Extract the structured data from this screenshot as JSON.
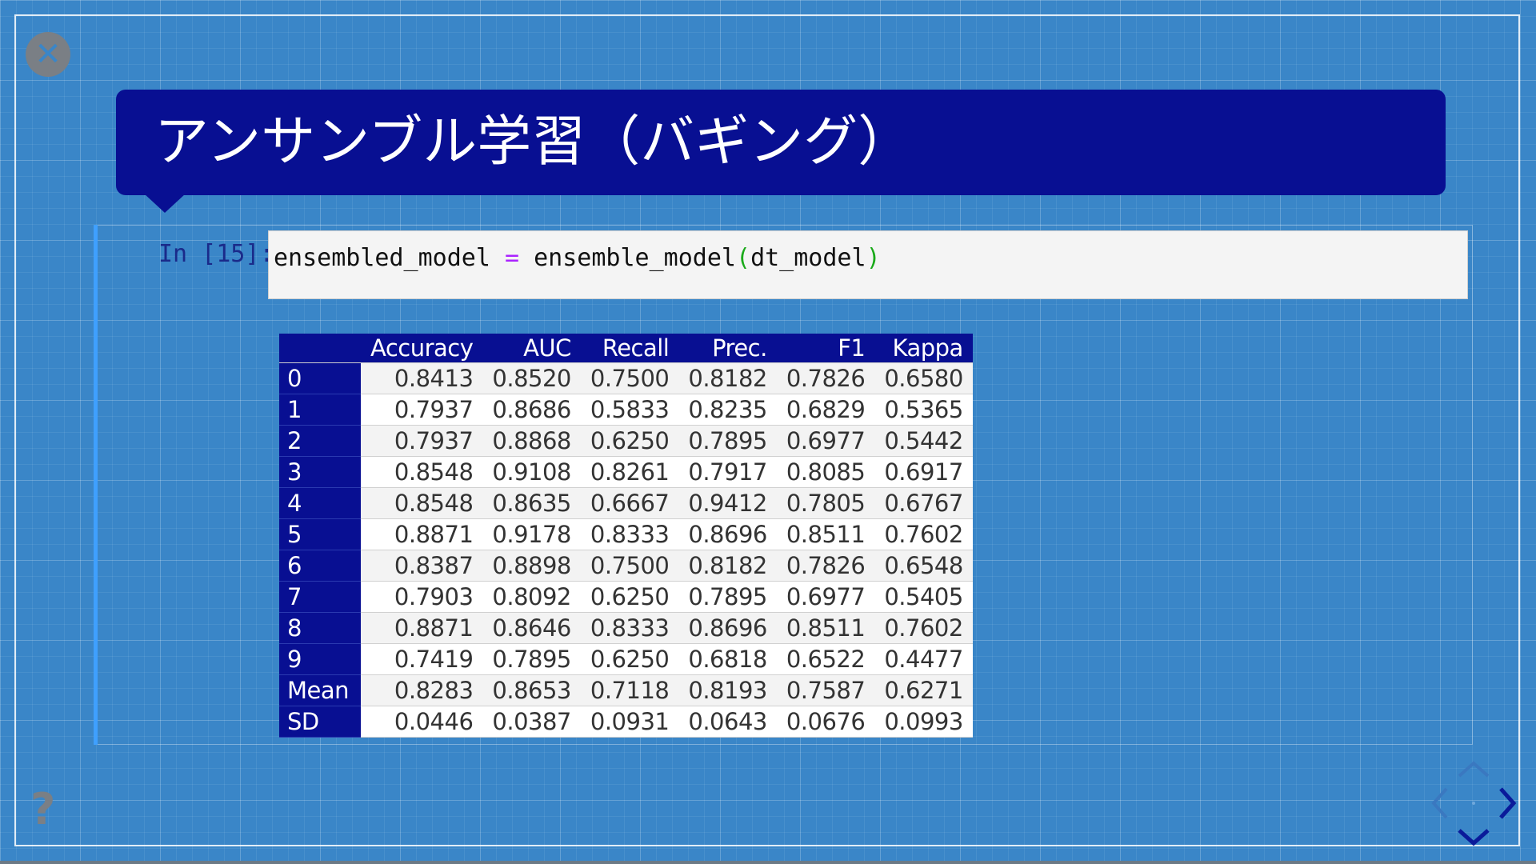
{
  "slide": {
    "title": "アンサンブル学習（バギング）",
    "close_icon": "close-icon",
    "help_icon": "help-icon",
    "help_glyph": "?"
  },
  "cell": {
    "prompt": "In [15]:",
    "code": {
      "lhs": "ensembled_model",
      "op": "=",
      "func": "ensemble_model",
      "open_paren": "(",
      "arg": "dt_model",
      "close_paren": ")"
    }
  },
  "table": {
    "columns": [
      "",
      "Accuracy",
      "AUC",
      "Recall",
      "Prec.",
      "F1",
      "Kappa"
    ],
    "rows": [
      {
        "label": "0",
        "values": [
          "0.8413",
          "0.8520",
          "0.7500",
          "0.8182",
          "0.7826",
          "0.6580"
        ]
      },
      {
        "label": "1",
        "values": [
          "0.7937",
          "0.8686",
          "0.5833",
          "0.8235",
          "0.6829",
          "0.5365"
        ]
      },
      {
        "label": "2",
        "values": [
          "0.7937",
          "0.8868",
          "0.6250",
          "0.7895",
          "0.6977",
          "0.5442"
        ]
      },
      {
        "label": "3",
        "values": [
          "0.8548",
          "0.9108",
          "0.8261",
          "0.7917",
          "0.8085",
          "0.6917"
        ]
      },
      {
        "label": "4",
        "values": [
          "0.8548",
          "0.8635",
          "0.6667",
          "0.9412",
          "0.7805",
          "0.6767"
        ]
      },
      {
        "label": "5",
        "values": [
          "0.8871",
          "0.9178",
          "0.8333",
          "0.8696",
          "0.8511",
          "0.7602"
        ]
      },
      {
        "label": "6",
        "values": [
          "0.8387",
          "0.8898",
          "0.7500",
          "0.8182",
          "0.7826",
          "0.6548"
        ]
      },
      {
        "label": "7",
        "values": [
          "0.7903",
          "0.8092",
          "0.6250",
          "0.7895",
          "0.6977",
          "0.5405"
        ]
      },
      {
        "label": "8",
        "values": [
          "0.8871",
          "0.8646",
          "0.8333",
          "0.8696",
          "0.8511",
          "0.7602"
        ]
      },
      {
        "label": "9",
        "values": [
          "0.7419",
          "0.7895",
          "0.6250",
          "0.6818",
          "0.6522",
          "0.4477"
        ]
      },
      {
        "label": "Mean",
        "values": [
          "0.8283",
          "0.8653",
          "0.7118",
          "0.8193",
          "0.7587",
          "0.6271"
        ]
      },
      {
        "label": "SD",
        "values": [
          "0.0446",
          "0.0387",
          "0.0931",
          "0.0643",
          "0.0676",
          "0.0993"
        ]
      }
    ]
  },
  "colors": {
    "background": "#3a86c8",
    "title_bg": "#080f92",
    "accent": "#3fa0ff",
    "keyword_op": "#aa22ff",
    "paren": "#1aaa1a"
  },
  "navigation": {
    "icons": [
      "nav-up-icon",
      "nav-left-icon",
      "nav-right-icon",
      "nav-down-icon"
    ]
  }
}
